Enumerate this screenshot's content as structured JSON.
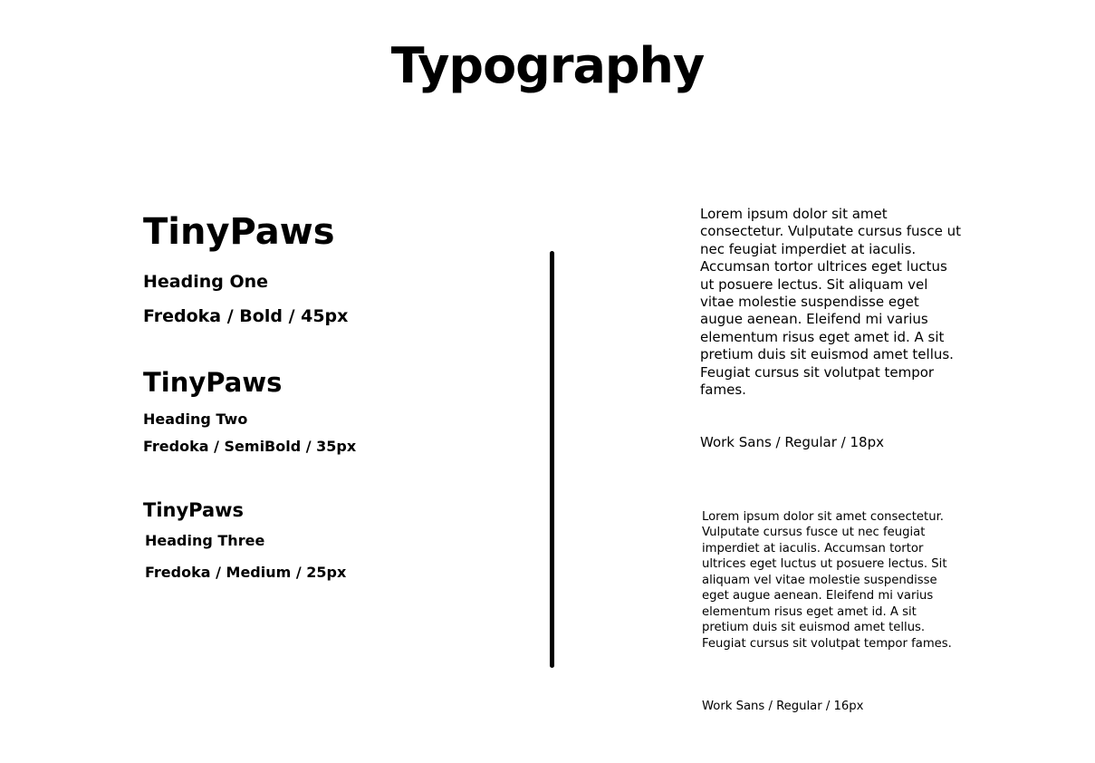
{
  "page": {
    "title": "Typography"
  },
  "headings": {
    "one": {
      "sample": "TinyPaws",
      "name": "Heading One",
      "spec": "Fredoka / Bold / 45px"
    },
    "two": {
      "sample": "TinyPaws",
      "name": "Heading Two",
      "spec": "Fredoka / SemiBold / 35px"
    },
    "three": {
      "sample": "TinyPaws",
      "name": "Heading Three",
      "spec": "Fredoka / Medium / 25px"
    }
  },
  "body_text": {
    "large": {
      "text": "Lorem ipsum dolor sit amet consectetur. Vulputate cursus fusce ut nec feugiat imperdiet at iaculis. Accumsan tortor ultrices eget luctus ut posuere lectus. Sit aliquam vel vitae molestie suspendisse eget augue aenean. Eleifend mi varius elementum risus eget amet id. A sit pretium duis sit euismod amet tellus. Feugiat cursus sit volutpat tempor fames.",
      "spec": "Work Sans / Regular / 18px"
    },
    "small": {
      "text": "Lorem ipsum dolor sit amet consectetur. Vulputate cursus fusce ut nec feugiat imperdiet at iaculis. Accumsan tortor ultrices eget luctus ut posuere lectus. Sit aliquam vel vitae molestie suspendisse eget augue aenean. Eleifend mi varius elementum risus eget amet id. A sit pretium duis sit euismod amet tellus. Feugiat cursus sit volutpat tempor fames.",
      "spec": "Work Sans / Regular / 16px"
    }
  },
  "colors": {
    "text": "#000000",
    "background": "#ffffff",
    "divider": "#000000"
  }
}
